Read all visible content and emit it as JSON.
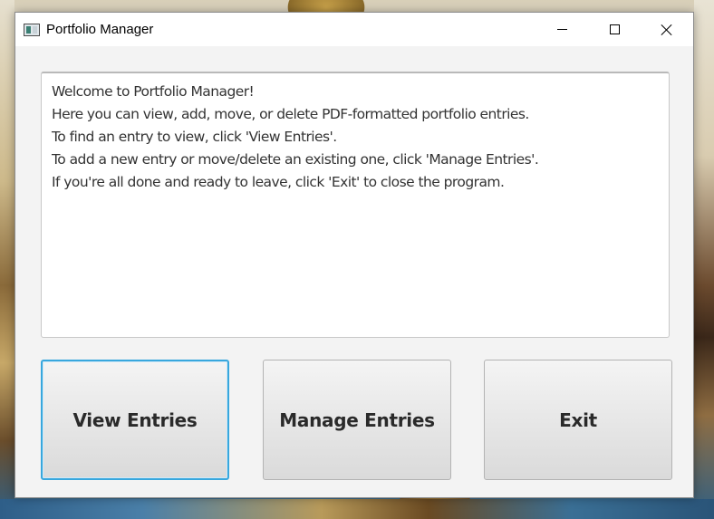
{
  "window": {
    "title": "Portfolio Manager",
    "controls": {
      "minimize": "minimize-icon",
      "maximize": "maximize-icon",
      "close": "close-icon"
    }
  },
  "welcome_text": [
    "Welcome to Portfolio Manager!",
    "Here you can view, add, move, or delete PDF-formatted portfolio entries.",
    "To find an entry to view, click 'View Entries'.",
    "To add a new entry or move/delete an existing one, click 'Manage Entries'.",
    "If you're all done and ready to leave, click 'Exit' to close the program."
  ],
  "buttons": {
    "view_entries": "View Entries",
    "manage_entries": "Manage Entries",
    "exit": "Exit"
  },
  "colors": {
    "focus_border": "#38a7dd",
    "window_bg": "#f3f3f3",
    "text": "#333333"
  }
}
